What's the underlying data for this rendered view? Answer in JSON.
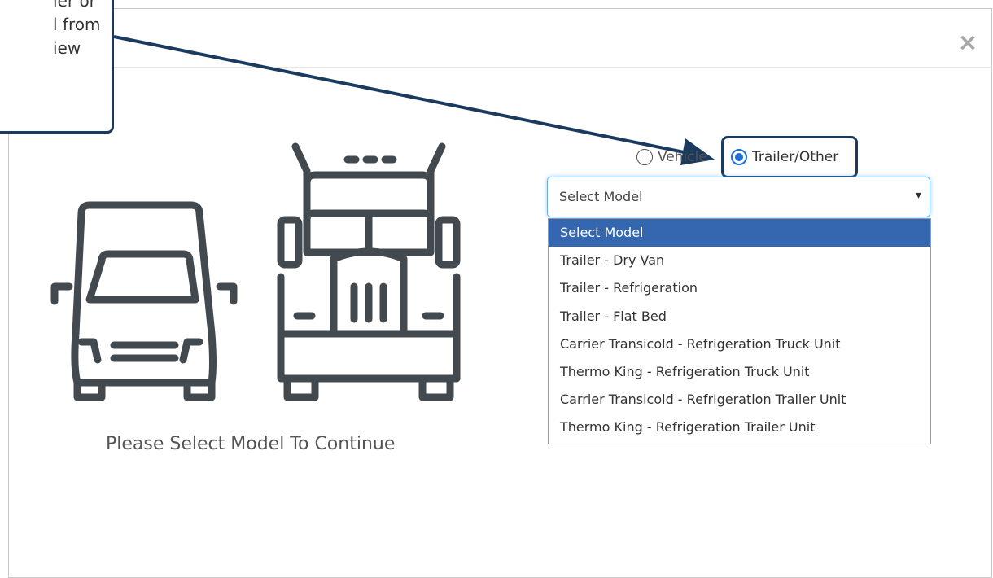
{
  "callout": {
    "text": "ler or\nl from\niew"
  },
  "modal": {
    "close_glyph": "×"
  },
  "illustration": {
    "continue_text": "Please Select Model To Continue",
    "van_icon": "van-icon",
    "truck_icon": "semi-truck-icon"
  },
  "radio_group": {
    "vehicle_label": "Vehicle",
    "trailer_label": "Trailer/Other",
    "selected": "Trailer/Other"
  },
  "select": {
    "value": "Select Model",
    "chevron": "⌄",
    "options": [
      "Select Model",
      "Trailer - Dry Van",
      "Trailer - Refrigeration",
      "Trailer - Flat Bed",
      "Carrier Transicold - Refrigeration Truck Unit",
      "Thermo King - Refrigeration Truck Unit",
      "Carrier Transicold - Refrigeration Trailer Unit",
      "Thermo King - Refrigeration Trailer Unit"
    ],
    "selected_index": 0
  },
  "colors": {
    "accent": "#1a3a5e",
    "highlight_option": "#3467b0",
    "radio_checked": "#1f6fd6",
    "icon_stroke": "#434a4f"
  }
}
